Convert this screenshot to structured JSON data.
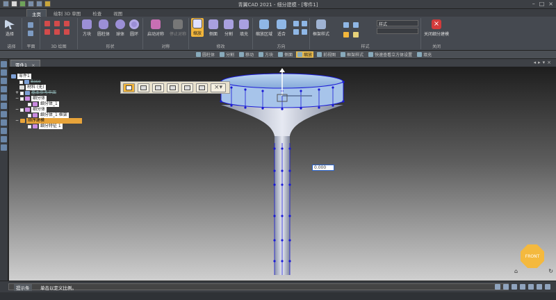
{
  "app": {
    "title": "青翼CAD 2021 - 细分建模 - [零件1]"
  },
  "ribbon_tabs": [
    "主页",
    "绘制 3D 草图",
    "检查",
    "视图"
  ],
  "ribbon": {
    "groups": [
      {
        "label": "选择",
        "buttons": [
          "选择"
        ]
      },
      {
        "label": "平面",
        "buttons": []
      },
      {
        "label": "3D 绘图",
        "buttons": []
      },
      {
        "label": "形状",
        "buttons": [
          "方块",
          "圆柱体",
          "球体",
          "圆环"
        ]
      },
      {
        "label": "对称",
        "buttons": [
          "启动对称",
          "停止对称"
        ]
      },
      {
        "label": "修改",
        "buttons": [
          "缩放",
          "侧面",
          "分割",
          "填充"
        ]
      },
      {
        "label": "方向",
        "buttons": [
          "缩放区域",
          "适合"
        ]
      },
      {
        "label": "样式",
        "buttons": [
          "框架样式"
        ]
      },
      {
        "label": "关闭",
        "buttons": [
          "关闭细分建模"
        ]
      }
    ],
    "style_dropdown": "样式"
  },
  "cmdbar": {
    "items": [
      "圆柱体",
      "分割",
      "移动",
      "方块",
      "侧面",
      "缩放",
      "前视图",
      "框架样式",
      "快速查看立方体设置",
      "填充"
    ]
  },
  "doc_tab": {
    "label": "零件1"
  },
  "tree": {
    "root": "零件1",
    "rows": [
      "Base",
      "材料 (无)",
      "基本参考平面",
      "细分体",
      "细分体_1",
      "细分体",
      "细分体_1 框架",
      "顺序建模",
      "细分特征 1"
    ]
  },
  "value_input": "0.000",
  "view_cube": {
    "label": "FRONT"
  },
  "status": {
    "prompt_label": "提示条",
    "prompt_text": "单击以定义比例。"
  },
  "colors": {
    "accent": "#f3b63b",
    "ribbon_bg": "#454950",
    "selection_blue": "#1a1ad6"
  }
}
